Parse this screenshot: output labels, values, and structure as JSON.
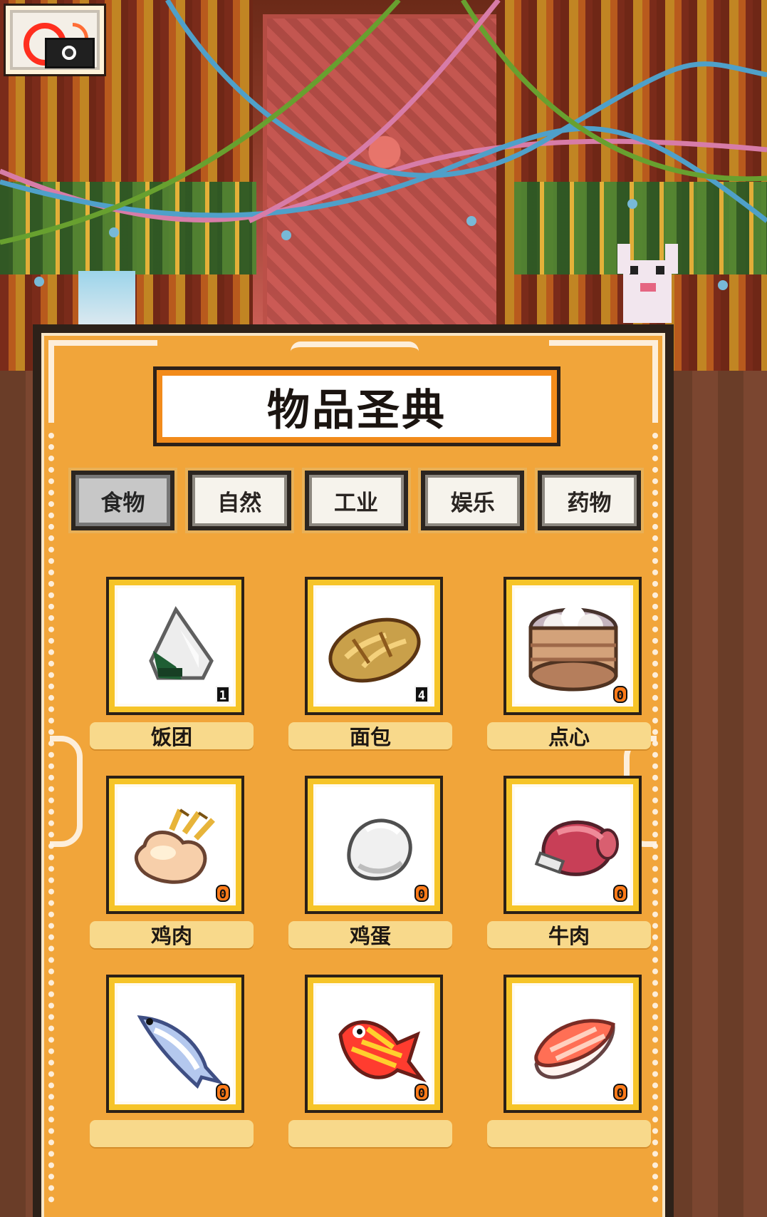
{
  "codex": {
    "title": "物品圣典"
  },
  "tabs": [
    {
      "label": "食物",
      "active": true
    },
    {
      "label": "自然",
      "active": false
    },
    {
      "label": "工业",
      "active": false
    },
    {
      "label": "娱乐",
      "active": false
    },
    {
      "label": "药物",
      "active": false
    }
  ],
  "items": [
    {
      "name": "饭团",
      "count": "1",
      "icon": "rice-ball-icon"
    },
    {
      "name": "面包",
      "count": "4",
      "icon": "bread-icon"
    },
    {
      "name": "点心",
      "count": "0",
      "icon": "dim-sum-icon"
    },
    {
      "name": "鸡肉",
      "count": "0",
      "icon": "roast-chicken-icon"
    },
    {
      "name": "鸡蛋",
      "count": "0",
      "icon": "egg-icon"
    },
    {
      "name": "牛肉",
      "count": "0",
      "icon": "beef-icon"
    },
    {
      "name": "",
      "count": "0",
      "icon": "blue-fish-icon"
    },
    {
      "name": "",
      "count": "0",
      "icon": "red-fish-icon"
    },
    {
      "name": "",
      "count": "0",
      "icon": "sushi-icon"
    }
  ],
  "colors": {
    "panel": "#f1a53a",
    "title_border": "#f28b1b",
    "item_frame": "#f6c428",
    "label_plate": "#f8d98b",
    "zero_badge": "#ff7a18"
  },
  "top_controls": {
    "camera_icon": "camera-icon"
  }
}
